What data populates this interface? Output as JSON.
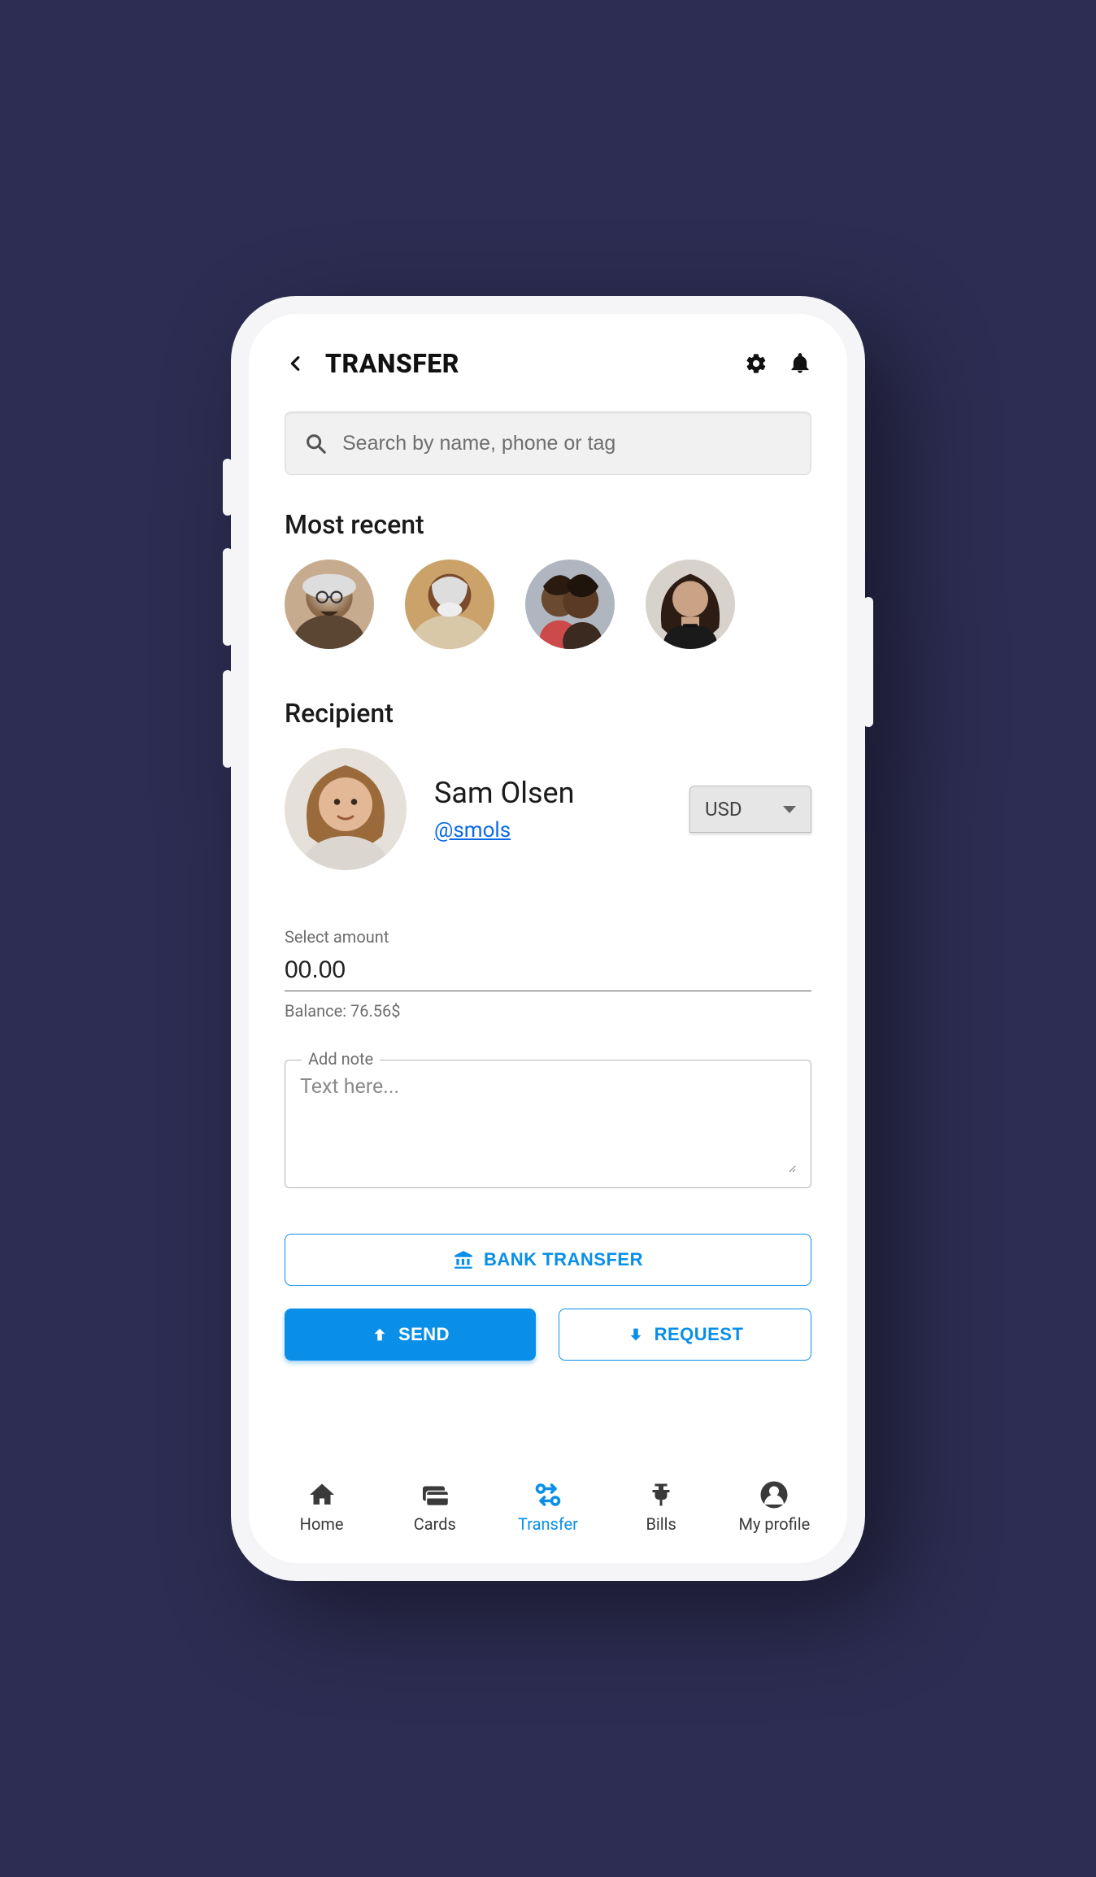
{
  "header": {
    "title": "TRANSFER"
  },
  "search": {
    "placeholder": "Search by name, phone or tag"
  },
  "sections": {
    "most_recent": "Most recent",
    "recipient": "Recipient"
  },
  "recent_contacts": [
    {
      "id": "contact-1"
    },
    {
      "id": "contact-2"
    },
    {
      "id": "contact-3"
    },
    {
      "id": "contact-4"
    }
  ],
  "recipient": {
    "name": "Sam Olsen",
    "handle": "@smols",
    "currency_selected": "USD"
  },
  "amount": {
    "label": "Select amount",
    "value": "00.00",
    "balance_text": "Balance: 76.56$"
  },
  "note": {
    "label": "Add note",
    "placeholder": "Text here..."
  },
  "buttons": {
    "bank_transfer": "Bank Transfer",
    "send": "Send",
    "request": "Request"
  },
  "nav": {
    "home": "Home",
    "cards": "Cards",
    "transfer": "Transfer",
    "bills": "Bills",
    "profile": "My profile",
    "active": "transfer"
  },
  "colors": {
    "accent": "#0a8fe8",
    "link": "#0a6ae6",
    "background_page": "#2d2d53"
  }
}
